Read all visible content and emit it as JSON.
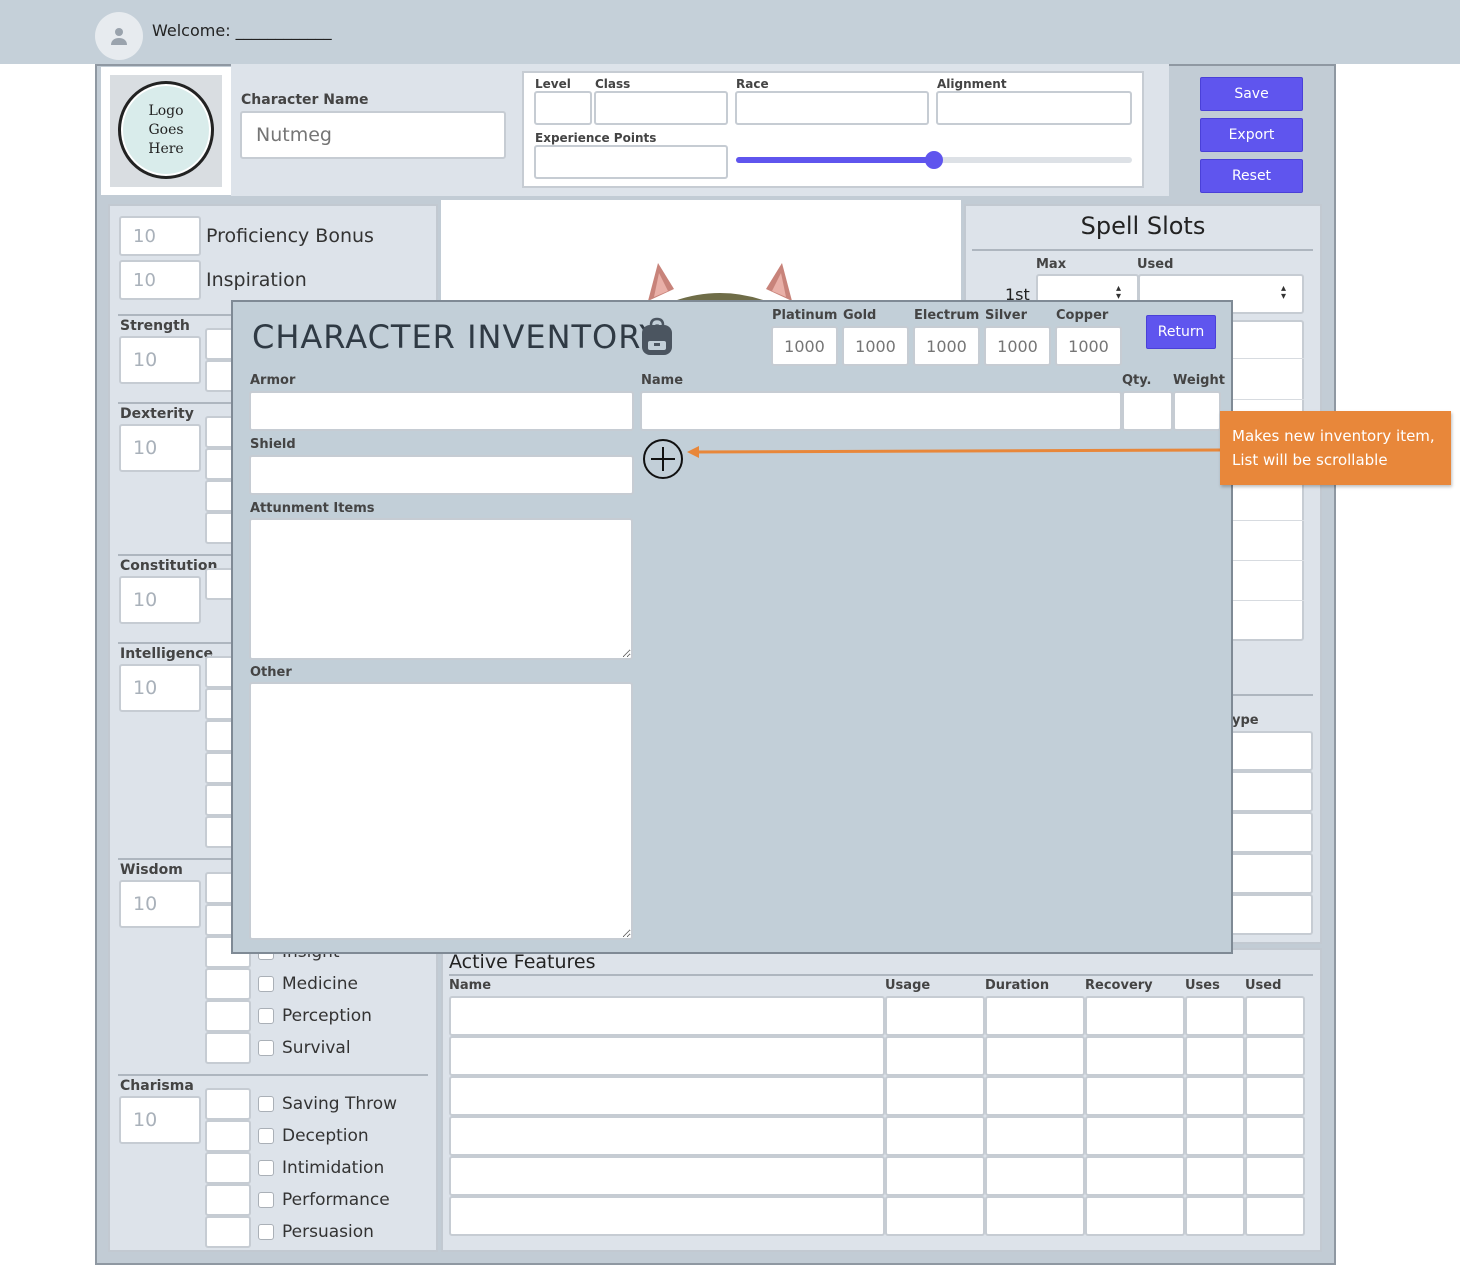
{
  "header": {
    "welcome": "Welcome: ____________"
  },
  "logo": {
    "text_lines": [
      "Logo",
      "Goes",
      "Here"
    ]
  },
  "character": {
    "name_label": "Character Name",
    "name_placeholder": "Nutmeg",
    "level_label": "Level",
    "class_label": "Class",
    "race_label": "Race",
    "alignment_label": "Alignment",
    "xp_label": "Experience Points",
    "xp_progress": 0.5
  },
  "actions": {
    "save": "Save",
    "export": "Export",
    "reset": "Reset"
  },
  "stats": {
    "proficiency_value": "10",
    "proficiency_label": "Proficiency Bonus",
    "inspiration_value": "10",
    "inspiration_label": "Inspiration",
    "abilities": [
      {
        "name": "Strength",
        "score": "10"
      },
      {
        "name": "Dexterity",
        "score": "10"
      },
      {
        "name": "Constitution",
        "score": "10"
      },
      {
        "name": "Intelligence",
        "score": "10"
      },
      {
        "name": "Wisdom",
        "score": "10"
      },
      {
        "name": "Charisma",
        "score": "10"
      }
    ],
    "wisdom_skills": [
      "Insight",
      "Medicine",
      "Perception",
      "Survival"
    ],
    "charisma_skills": [
      "Saving Throw",
      "Deception",
      "Intimidation",
      "Performance",
      "Persuasion"
    ]
  },
  "spell_slots": {
    "title": "Spell Slots",
    "max_label": "Max",
    "used_label": "Used",
    "first_level": "1st",
    "type_label_partial": "ype"
  },
  "active_features": {
    "title": "Active Features",
    "columns": [
      "Name",
      "Usage",
      "Duration",
      "Recovery",
      "Uses",
      "Used"
    ]
  },
  "inventory": {
    "title": "CHARACTER INVENTORY",
    "currencies": [
      {
        "label": "Platinum",
        "placeholder": "1000"
      },
      {
        "label": "Gold",
        "placeholder": "1000"
      },
      {
        "label": "Electrum",
        "placeholder": "1000"
      },
      {
        "label": "Silver",
        "placeholder": "1000"
      },
      {
        "label": "Copper",
        "placeholder": "1000"
      }
    ],
    "return_label": "Return",
    "armor_label": "Armor",
    "shield_label": "Shield",
    "attunement_label": "Attunment Items",
    "other_label": "Other",
    "name_label": "Name",
    "qty_label": "Qty.",
    "weight_label": "Weight"
  },
  "annotation": {
    "line1": "Makes new inventory item,",
    "line2": "List will be scrollable",
    "color": "#e8873a"
  },
  "colors": {
    "accent": "#5f55ee",
    "header_bg": "#c5d0d9",
    "panel_bg": "#dde3ea",
    "modal_bg": "#c2cfd8"
  }
}
